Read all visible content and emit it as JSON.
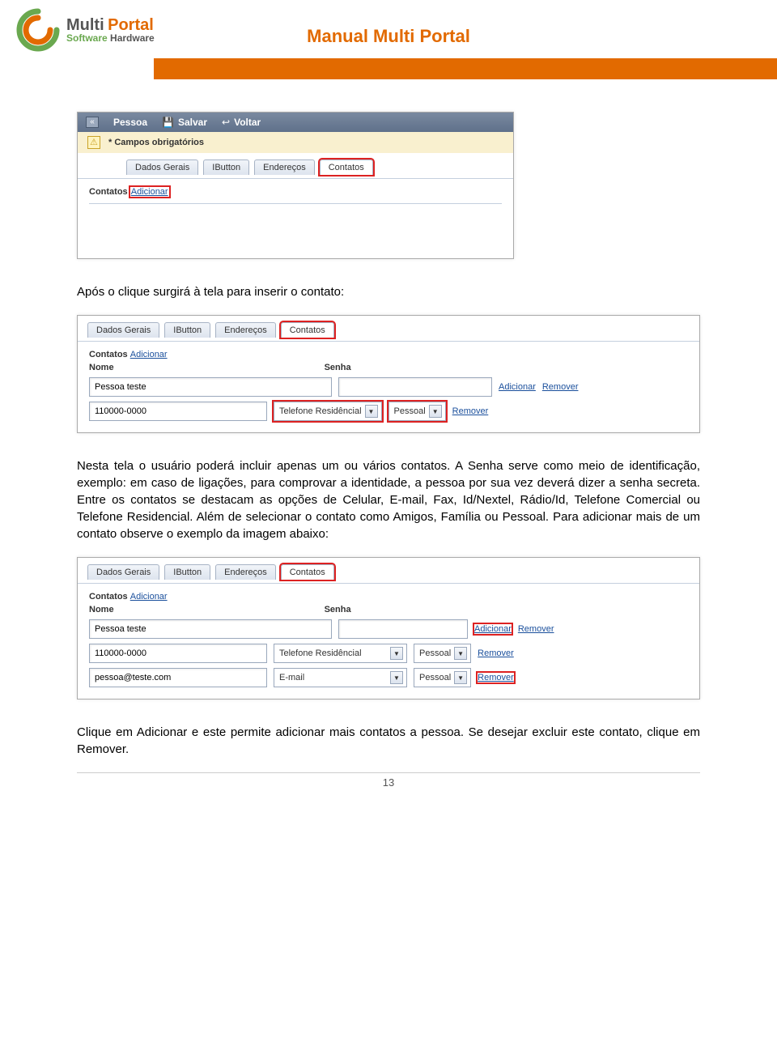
{
  "header": {
    "logo_brand_a": "Multi",
    "logo_brand_b": "Portal",
    "logo_sub_a": "Software",
    "logo_sub_b": "Hardware",
    "doc_title": "Manual Multi Portal"
  },
  "shot1": {
    "toolbar": {
      "pessoa": "Pessoa",
      "salvar": "Salvar",
      "voltar": "Voltar"
    },
    "warn": "* Campos obrigatórios",
    "tabs": {
      "t1": "Dados Gerais",
      "t2": "IButton",
      "t3": "Endereços",
      "t4": "Contatos"
    },
    "contatos_label": "Contatos",
    "adicionar": "Adicionar"
  },
  "para1": "Após o clique surgirá à tela para inserir o contato:",
  "shot2": {
    "tabs": {
      "t1": "Dados Gerais",
      "t2": "IButton",
      "t3": "Endereços",
      "t4": "Contatos"
    },
    "contatos_label": "Contatos",
    "adicionar": "Adicionar",
    "col_nome": "Nome",
    "col_senha": "Senha",
    "nome_value": "Pessoa teste",
    "add_link": "Adicionar",
    "remover_link": "Remover",
    "telefone_value": "110000-0000",
    "tipo_select": "Telefone Residêncial",
    "categoria_select": "Pessoal",
    "remover2": "Remover"
  },
  "para2": "Nesta tela o usuário poderá incluir apenas um ou vários contatos. A Senha serve como meio de identificação, exemplo: em caso de ligações, para comprovar a identidade, a pessoa por sua vez deverá dizer a senha secreta. Entre os contatos se destacam as opções de Celular, E-mail, Fax, Id/Nextel, Rádio/Id, Telefone Comercial ou Telefone Residencial. Além de selecionar o contato como Amigos, Família ou Pessoal. Para adicionar mais de um contato observe o exemplo da imagem abaixo:",
  "shot3": {
    "tabs": {
      "t1": "Dados Gerais",
      "t2": "IButton",
      "t3": "Endereços",
      "t4": "Contatos"
    },
    "contatos_label": "Contatos",
    "adicionar": "Adicionar",
    "col_nome": "Nome",
    "col_senha": "Senha",
    "nome_value": "Pessoa teste",
    "add_link": "Adicionar",
    "remover_link": "Remover",
    "r1_val": "110000-0000",
    "r1_tipo": "Telefone Residêncial",
    "r1_cat": "Pessoal",
    "r1_rem": "Remover",
    "r2_val": "pessoa@teste.com",
    "r2_tipo": "E-mail",
    "r2_cat": "Pessoal",
    "r2_rem": "Remover"
  },
  "para3": "Clique em Adicionar e este permite adicionar mais contatos a pessoa. Se desejar excluir este contato, clique em Remover.",
  "page_number": "13"
}
